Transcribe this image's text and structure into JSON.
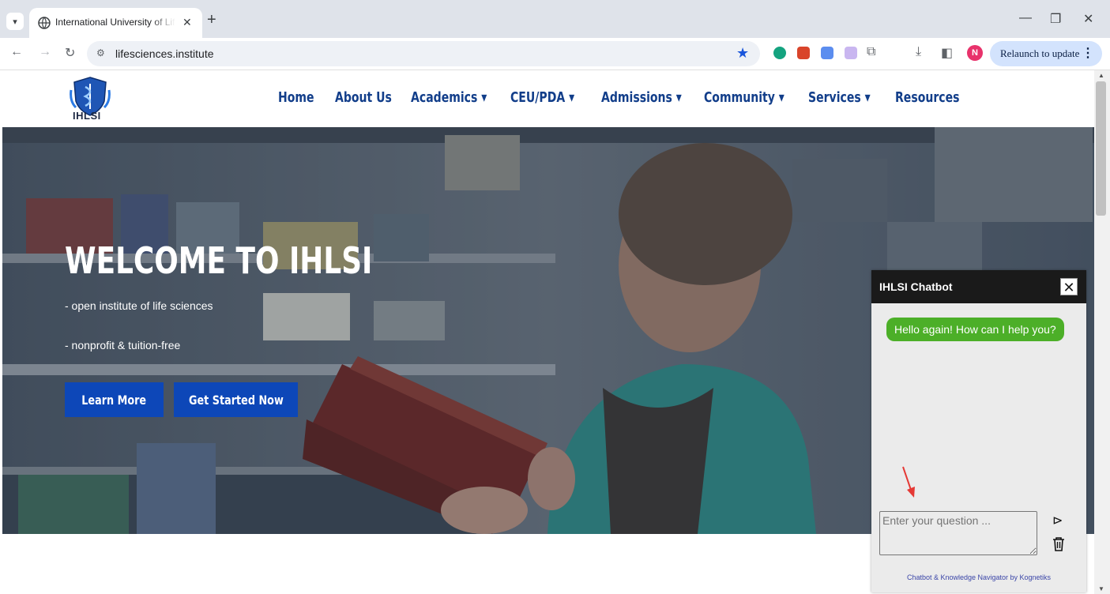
{
  "browser": {
    "tab_title": "International University of Lif",
    "tab_close": "✕",
    "new_tab": "+",
    "url": "lifesciences.institute",
    "profile_initial": "N",
    "relaunch_label": "Relaunch to update",
    "window_controls": [
      "—",
      "❐",
      "✕"
    ]
  },
  "site": {
    "logo_text": "IHLSI",
    "nav": [
      "Home",
      "About Us",
      "Academics ▾",
      "CEU/PDA ▾",
      "Admissions ▾",
      "Community ▾",
      "Services ▾",
      "Resources"
    ]
  },
  "hero": {
    "title": "WELCOME TO IHLSI",
    "line1": "- open institute of life sciences",
    "line2": "- nonprofit & tuition-free",
    "learn_more": "Learn More",
    "get_started": "Get Started Now"
  },
  "chatbot": {
    "title": "IHLSI Chatbot",
    "close": "✕",
    "greeting": "Hello again! How can I help you?",
    "input_placeholder": "Enter your question ...",
    "send": "⊳",
    "footer": "Chatbot & Knowledge Navigator by Kognetiks"
  },
  "colors": {
    "nav_text": "#123e8a",
    "hero_button": "#0d47b8",
    "chat_bubble": "#4caf28",
    "chat_header": "#1a1a1a",
    "relaunch_bg": "#d3e3fd"
  }
}
